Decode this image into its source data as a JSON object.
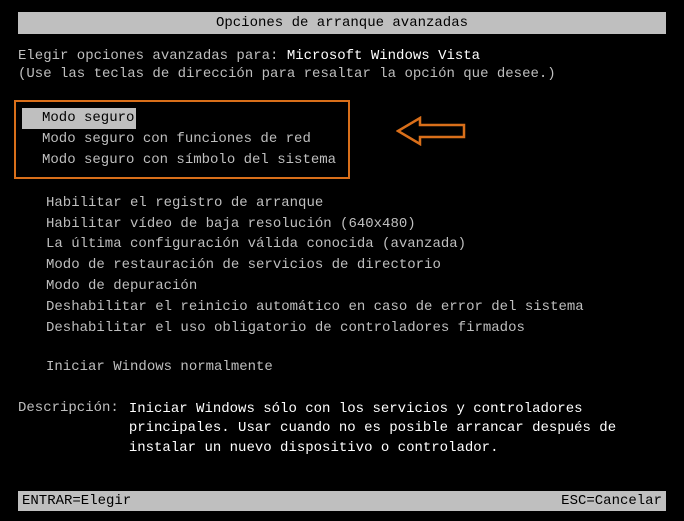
{
  "title": "Opciones de arranque avanzadas",
  "intro": {
    "prefix": "Elegir opciones avanzadas para: ",
    "os_name": "Microsoft Windows Vista",
    "hint": "(Use las teclas de dirección para resaltar la opción que desee.)"
  },
  "safe_mode_options": [
    "Modo seguro",
    "Modo seguro con funciones de red",
    "Modo seguro con símbolo del sistema"
  ],
  "other_options": [
    "Habilitar el registro de arranque",
    "Habilitar vídeo de baja resolución (640x480)",
    "La última configuración válida conocida (avanzada)",
    "Modo de restauración de servicios de directorio",
    "Modo de depuración",
    "Deshabilitar el reinicio automático en caso de error del sistema",
    "Deshabilitar el uso obligatorio de controladores firmados"
  ],
  "normal_option": "Iniciar Windows normalmente",
  "description": {
    "label": "Descripción:",
    "text": "Iniciar Windows sólo con los servicios y controladores principales. Usar cuando no es posible arrancar después de instalar un nuevo dispositivo o controlador."
  },
  "footer": {
    "enter": "ENTRAR=Elegir",
    "esc": "ESC=Cancelar"
  },
  "colors": {
    "highlight_border": "#d96f1a",
    "text": "#bfbfbf",
    "bright": "#ffffff",
    "bg": "#000000"
  }
}
